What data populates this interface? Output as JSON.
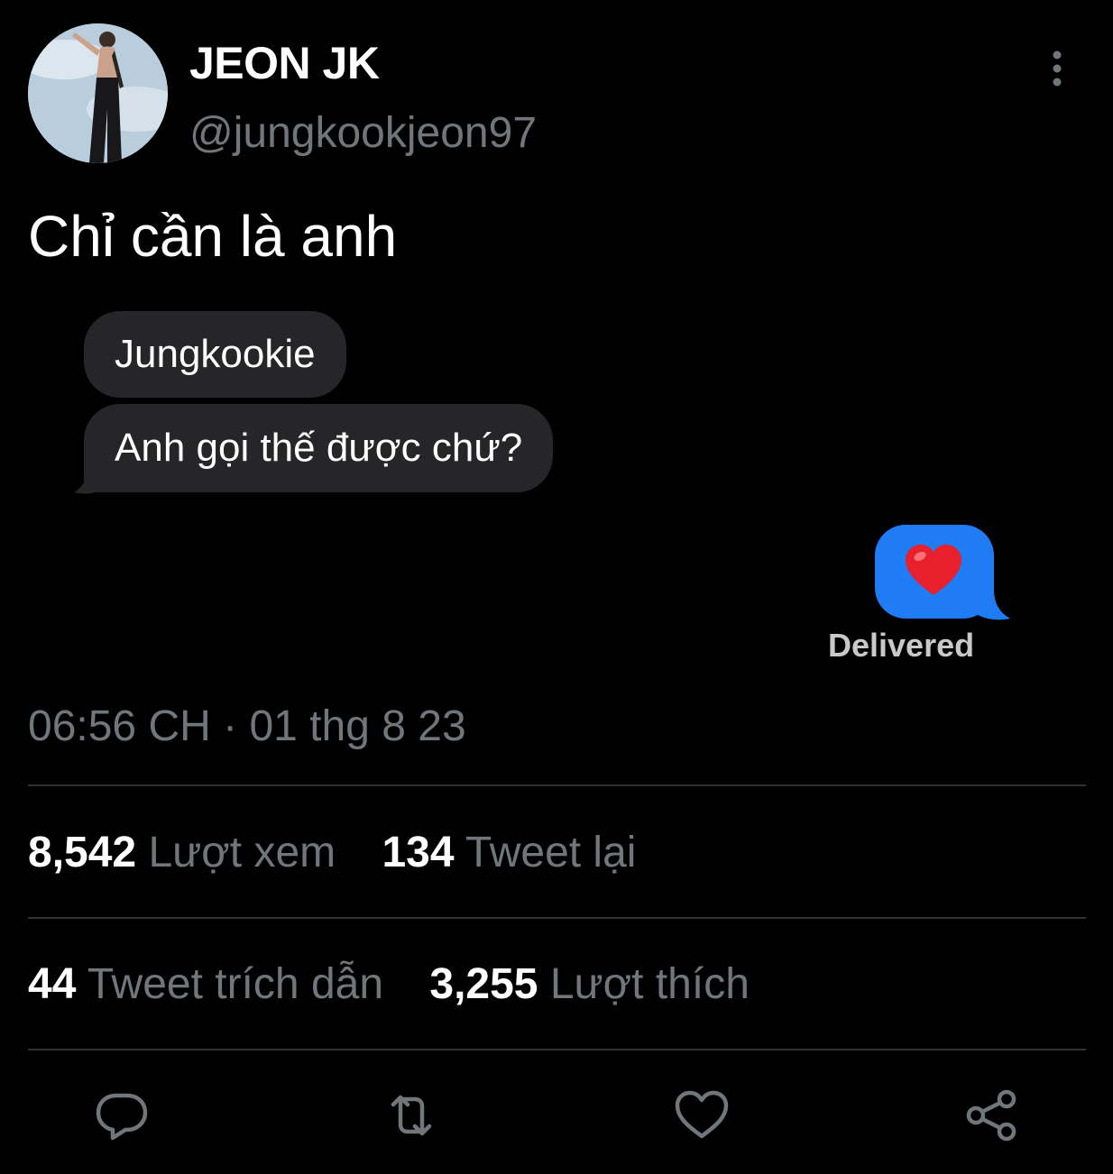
{
  "author": {
    "display_name": "JEON JK",
    "handle": "@jungkookjeon97"
  },
  "tweet": {
    "text": "Chỉ cần là anh",
    "timestamp": "06:56 CH · 01 thg 8 23"
  },
  "media": {
    "received_messages": [
      "Jungkookie",
      "Anh gọi thế được chứ?"
    ],
    "sent_message_icon": "red-heart-emoji",
    "delivery_status": "Delivered",
    "colors": {
      "received_bubble": "#262629",
      "sent_bubble": "#1f7cf5"
    }
  },
  "stats": {
    "views_count": "8,542",
    "views_label": "Lượt xem",
    "retweets_count": "134",
    "retweets_label": "Tweet lại",
    "quotes_count": "44",
    "quotes_label": "Tweet trích dẫn",
    "likes_count": "3,255",
    "likes_label": "Lượt thích"
  },
  "actions": {
    "icons": [
      "reply-icon",
      "retweet-icon",
      "like-icon",
      "share-icon"
    ]
  },
  "colors": {
    "background": "#000000",
    "primary_text": "#ffffff",
    "secondary_text": "#71767b",
    "divider": "#2f3336"
  }
}
